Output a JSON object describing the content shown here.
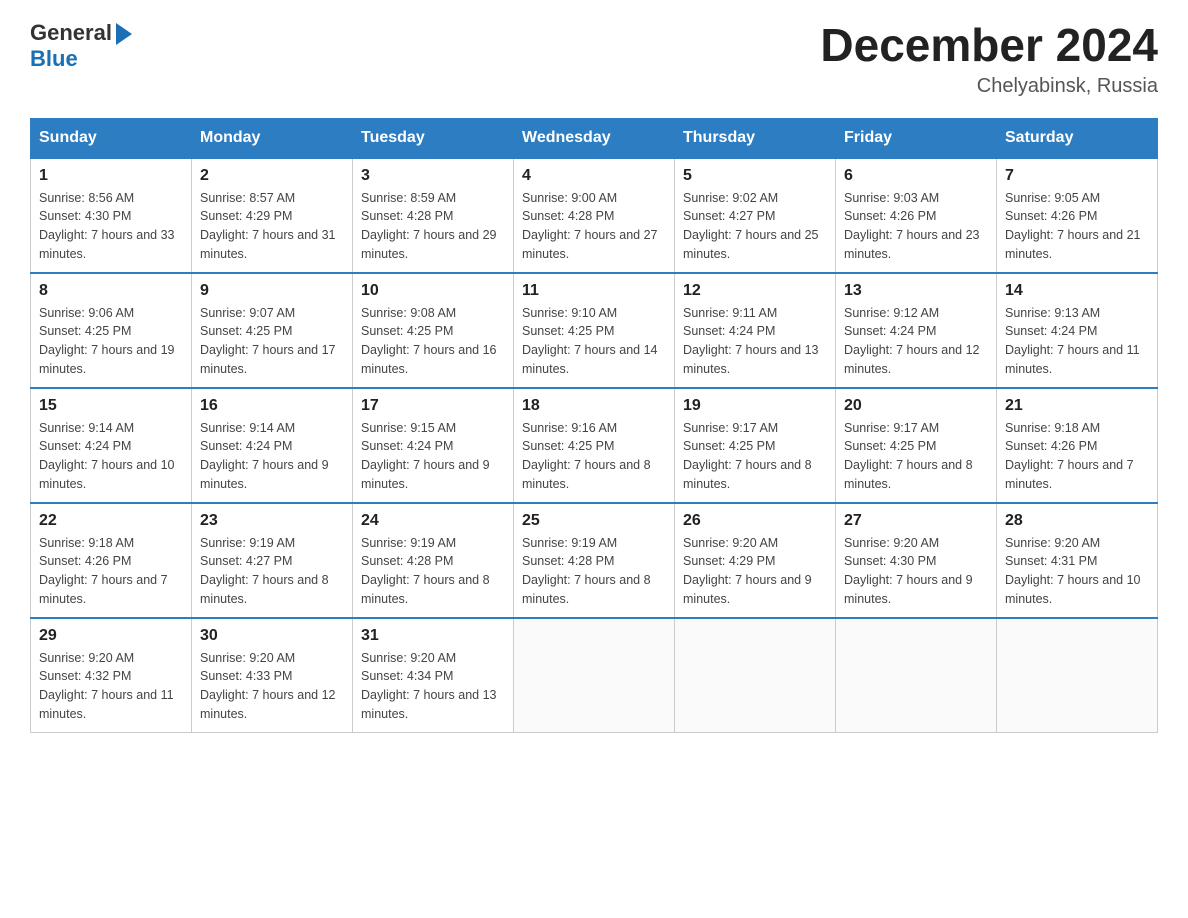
{
  "header": {
    "logo_general": "General",
    "logo_blue": "Blue",
    "month_title": "December 2024",
    "location": "Chelyabinsk, Russia"
  },
  "days_of_week": [
    "Sunday",
    "Monday",
    "Tuesday",
    "Wednesday",
    "Thursday",
    "Friday",
    "Saturday"
  ],
  "weeks": [
    [
      {
        "day": "1",
        "sunrise": "8:56 AM",
        "sunset": "4:30 PM",
        "daylight": "7 hours and 33 minutes."
      },
      {
        "day": "2",
        "sunrise": "8:57 AM",
        "sunset": "4:29 PM",
        "daylight": "7 hours and 31 minutes."
      },
      {
        "day": "3",
        "sunrise": "8:59 AM",
        "sunset": "4:28 PM",
        "daylight": "7 hours and 29 minutes."
      },
      {
        "day": "4",
        "sunrise": "9:00 AM",
        "sunset": "4:28 PM",
        "daylight": "7 hours and 27 minutes."
      },
      {
        "day": "5",
        "sunrise": "9:02 AM",
        "sunset": "4:27 PM",
        "daylight": "7 hours and 25 minutes."
      },
      {
        "day": "6",
        "sunrise": "9:03 AM",
        "sunset": "4:26 PM",
        "daylight": "7 hours and 23 minutes."
      },
      {
        "day": "7",
        "sunrise": "9:05 AM",
        "sunset": "4:26 PM",
        "daylight": "7 hours and 21 minutes."
      }
    ],
    [
      {
        "day": "8",
        "sunrise": "9:06 AM",
        "sunset": "4:25 PM",
        "daylight": "7 hours and 19 minutes."
      },
      {
        "day": "9",
        "sunrise": "9:07 AM",
        "sunset": "4:25 PM",
        "daylight": "7 hours and 17 minutes."
      },
      {
        "day": "10",
        "sunrise": "9:08 AM",
        "sunset": "4:25 PM",
        "daylight": "7 hours and 16 minutes."
      },
      {
        "day": "11",
        "sunrise": "9:10 AM",
        "sunset": "4:25 PM",
        "daylight": "7 hours and 14 minutes."
      },
      {
        "day": "12",
        "sunrise": "9:11 AM",
        "sunset": "4:24 PM",
        "daylight": "7 hours and 13 minutes."
      },
      {
        "day": "13",
        "sunrise": "9:12 AM",
        "sunset": "4:24 PM",
        "daylight": "7 hours and 12 minutes."
      },
      {
        "day": "14",
        "sunrise": "9:13 AM",
        "sunset": "4:24 PM",
        "daylight": "7 hours and 11 minutes."
      }
    ],
    [
      {
        "day": "15",
        "sunrise": "9:14 AM",
        "sunset": "4:24 PM",
        "daylight": "7 hours and 10 minutes."
      },
      {
        "day": "16",
        "sunrise": "9:14 AM",
        "sunset": "4:24 PM",
        "daylight": "7 hours and 9 minutes."
      },
      {
        "day": "17",
        "sunrise": "9:15 AM",
        "sunset": "4:24 PM",
        "daylight": "7 hours and 9 minutes."
      },
      {
        "day": "18",
        "sunrise": "9:16 AM",
        "sunset": "4:25 PM",
        "daylight": "7 hours and 8 minutes."
      },
      {
        "day": "19",
        "sunrise": "9:17 AM",
        "sunset": "4:25 PM",
        "daylight": "7 hours and 8 minutes."
      },
      {
        "day": "20",
        "sunrise": "9:17 AM",
        "sunset": "4:25 PM",
        "daylight": "7 hours and 8 minutes."
      },
      {
        "day": "21",
        "sunrise": "9:18 AM",
        "sunset": "4:26 PM",
        "daylight": "7 hours and 7 minutes."
      }
    ],
    [
      {
        "day": "22",
        "sunrise": "9:18 AM",
        "sunset": "4:26 PM",
        "daylight": "7 hours and 7 minutes."
      },
      {
        "day": "23",
        "sunrise": "9:19 AM",
        "sunset": "4:27 PM",
        "daylight": "7 hours and 8 minutes."
      },
      {
        "day": "24",
        "sunrise": "9:19 AM",
        "sunset": "4:28 PM",
        "daylight": "7 hours and 8 minutes."
      },
      {
        "day": "25",
        "sunrise": "9:19 AM",
        "sunset": "4:28 PM",
        "daylight": "7 hours and 8 minutes."
      },
      {
        "day": "26",
        "sunrise": "9:20 AM",
        "sunset": "4:29 PM",
        "daylight": "7 hours and 9 minutes."
      },
      {
        "day": "27",
        "sunrise": "9:20 AM",
        "sunset": "4:30 PM",
        "daylight": "7 hours and 9 minutes."
      },
      {
        "day": "28",
        "sunrise": "9:20 AM",
        "sunset": "4:31 PM",
        "daylight": "7 hours and 10 minutes."
      }
    ],
    [
      {
        "day": "29",
        "sunrise": "9:20 AM",
        "sunset": "4:32 PM",
        "daylight": "7 hours and 11 minutes."
      },
      {
        "day": "30",
        "sunrise": "9:20 AM",
        "sunset": "4:33 PM",
        "daylight": "7 hours and 12 minutes."
      },
      {
        "day": "31",
        "sunrise": "9:20 AM",
        "sunset": "4:34 PM",
        "daylight": "7 hours and 13 minutes."
      },
      null,
      null,
      null,
      null
    ]
  ]
}
